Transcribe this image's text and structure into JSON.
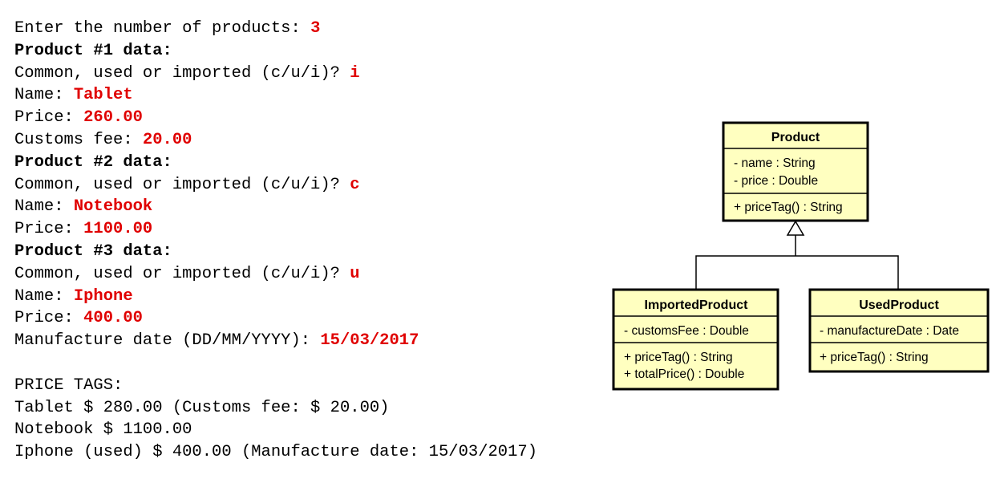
{
  "console": {
    "lines": [
      {
        "type": "prompt",
        "label": "Enter the number of products: ",
        "value": "3"
      },
      {
        "type": "heading",
        "text": "Product #1 data:"
      },
      {
        "type": "prompt",
        "label": "Common, used or imported (c/u/i)? ",
        "value": "i"
      },
      {
        "type": "prompt",
        "label": "Name: ",
        "value": "Tablet"
      },
      {
        "type": "prompt",
        "label": "Price: ",
        "value": "260.00"
      },
      {
        "type": "prompt",
        "label": "Customs fee: ",
        "value": "20.00"
      },
      {
        "type": "heading",
        "text": "Product #2 data:"
      },
      {
        "type": "prompt",
        "label": "Common, used or imported (c/u/i)? ",
        "value": "c"
      },
      {
        "type": "prompt",
        "label": "Name: ",
        "value": "Notebook"
      },
      {
        "type": "prompt",
        "label": "Price: ",
        "value": "1100.00"
      },
      {
        "type": "heading",
        "text": "Product #3 data:"
      },
      {
        "type": "prompt",
        "label": "Common, used or imported (c/u/i)? ",
        "value": "u"
      },
      {
        "type": "prompt",
        "label": "Name: ",
        "value": "Iphone"
      },
      {
        "type": "prompt",
        "label": "Price: ",
        "value": "400.00"
      },
      {
        "type": "prompt",
        "label": "Manufacture date (DD/MM/YYYY): ",
        "value": "15/03/2017"
      },
      {
        "type": "blank"
      },
      {
        "type": "output",
        "text": "PRICE TAGS:"
      },
      {
        "type": "output",
        "text": "Tablet $ 280.00 (Customs fee: $ 20.00)"
      },
      {
        "type": "output",
        "text": "Notebook $ 1100.00"
      },
      {
        "type": "output",
        "text": "Iphone (used) $ 400.00 (Manufacture date: 15/03/2017)"
      }
    ]
  },
  "uml": {
    "classes": {
      "product": {
        "name": "Product",
        "attributes": [
          "- name : String",
          "- price : Double"
        ],
        "methods": [
          "+ priceTag() : String"
        ]
      },
      "imported": {
        "name": "ImportedProduct",
        "attributes": [
          "- customsFee : Double"
        ],
        "methods": [
          "+ priceTag() : String",
          "+ totalPrice() : Double"
        ]
      },
      "used": {
        "name": "UsedProduct",
        "attributes": [
          "- manufactureDate : Date"
        ],
        "methods": [
          "+ priceTag() : String"
        ]
      }
    },
    "colors": {
      "class_fill": "#ffffc0",
      "border": "#000000",
      "connector": "#000000"
    }
  },
  "colors": {
    "input_text": "#e00000",
    "console_text": "#000000"
  }
}
